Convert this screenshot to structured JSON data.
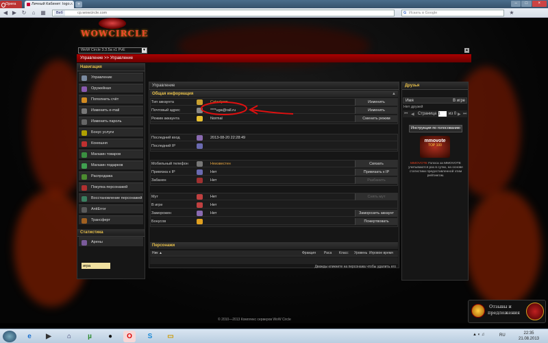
{
  "browser": {
    "opera_label": "Opera",
    "tab_title": "Личный Кабинет: logo...",
    "url": "cp.wowcircle.com",
    "web_label": "Веб",
    "search_placeholder": "Искать в Google",
    "new_tab": "+"
  },
  "site": {
    "logo": "WOWCIRCLE",
    "realm_select": "WoW Circle 3.3.5a x1 PvE",
    "breadcrumb": "Управление >> Управление",
    "footer": "© 2010—2013 Комплекс серверов WoW Circle"
  },
  "sidebar": {
    "nav_title": "Навигация",
    "items": [
      {
        "label": "Управление",
        "icon": "gear-icon",
        "color": "#7a8aa0"
      },
      {
        "label": "Оружейная",
        "icon": "crossed-swords-icon",
        "color": "#8a5ab0"
      },
      {
        "label": "Пополнить счёт",
        "icon": "coins-icon",
        "color": "#d28a20"
      },
      {
        "label": "Изменить e-mail",
        "icon": "envelope-icon",
        "color": "#777"
      },
      {
        "label": "Изменить пароль",
        "icon": "key-icon",
        "color": "#666"
      },
      {
        "label": "Бонус услуги",
        "icon": "bonus-icon",
        "color": "#b0a000"
      },
      {
        "label": "Конюшня",
        "icon": "horse-icon",
        "color": "#c03030"
      },
      {
        "label": "Магазин товаров",
        "icon": "shop-icon",
        "color": "#3a9040"
      },
      {
        "label": "Магазин подарков",
        "icon": "gift-icon",
        "color": "#40a050"
      },
      {
        "label": "Распродажа",
        "icon": "sale-icon",
        "color": "#4c8c30"
      },
      {
        "label": "Покупка персонажей",
        "icon": "character-buy-icon",
        "color": "#b03030"
      },
      {
        "label": "Восстановление персонажей",
        "icon": "restore-icon",
        "color": "#3a8060"
      },
      {
        "label": "AntiError",
        "icon": "antierror-icon",
        "color": "#5a5a5a"
      },
      {
        "label": "Трансферт",
        "icon": "transfer-icon",
        "color": "#a06020"
      }
    ],
    "stats_title": "Статистика",
    "stats_items": [
      {
        "label": "Арены",
        "icon": "arena-icon",
        "color": "#7a5a9a"
      }
    ],
    "input_value": "игра"
  },
  "main": {
    "title": "Управление",
    "general_title": "Общая информация",
    "general": [
      {
        "key": "Тип аккаунта",
        "value": "Cataclysm",
        "button": "Изменить",
        "icon": "expansion-icon",
        "icon_color": "#c9a030",
        "gold": true
      },
      {
        "key": "Почтовый адрес",
        "value": "****uga@rall.ru",
        "button": "Изменить",
        "icon": "mail-icon",
        "icon_color": "#888",
        "gold": false
      },
      {
        "key": "Режим аккаунта",
        "value": "Normal",
        "button": "Сменить режим",
        "icon": "star-icon",
        "icon_color": "#e8c030",
        "gold": false
      }
    ],
    "login": [
      {
        "key": "Последний вход",
        "value": "2013-08-20 22:28:49",
        "icon": "clock-icon",
        "icon_color": "#8a6ab0"
      },
      {
        "key": "Последний IP",
        "value": "",
        "icon": "network-icon",
        "icon_color": "#6a6ab0"
      }
    ],
    "security": [
      {
        "key": "Мобильный телефон",
        "value": "Неизвестен",
        "button": "Связать",
        "icon": "phone-icon",
        "icon_color": "#777",
        "dis": false,
        "gold": true
      },
      {
        "key": "Привязка к IP",
        "value": "Нет",
        "button": "Привязать к IP",
        "icon": "lock-icon",
        "icon_color": "#6a6ab0",
        "dis": false,
        "gold": false
      },
      {
        "key": "Забанен",
        "value": "Нет",
        "button": "Разбанить",
        "icon": "ban-icon",
        "icon_color": "#a03030",
        "dis": true,
        "gold": false
      }
    ],
    "status": [
      {
        "key": "Мут",
        "value": "Нет",
        "button": "Снять мут",
        "icon": "mute-icon",
        "icon_color": "#c04040",
        "dis": true
      },
      {
        "key": "В игре",
        "value": "Нет",
        "button": "",
        "icon": "game-icon",
        "icon_color": "#c04040",
        "dis": false
      },
      {
        "key": "Заморожен",
        "value": "Нет",
        "button": "Заморозить аккаунт",
        "icon": "freeze-icon",
        "icon_color": "#8a6ab0",
        "dis": false
      },
      {
        "key": "Бонусов",
        "value": "",
        "button": "Пожертвовать",
        "icon": "bonus-coin-icon",
        "icon_color": "#e0a020",
        "dis": false
      }
    ],
    "chars_title": "Персонажи",
    "chars_columns": [
      "Ник ▲",
      "Фракция",
      "Раса",
      "Класс",
      "Уровень",
      "Игровое время"
    ],
    "chars_hint": "Дважды кликните на персонажа чтобы удалить его"
  },
  "right": {
    "title": "Друзья",
    "col_name": "Имя",
    "col_status": "В игре",
    "no_friends": "Нет друзей",
    "page_label": "Страница",
    "page_value": "1",
    "page_of": "из 0",
    "vote_button": "Инструкция по голосованию",
    "mmovote_title": "mmovote",
    "mmovote_sub": "TOP 100",
    "vote_link": "MMOVOTE",
    "vote_text": "Голоса за MMOVOTE учитываются раз в сутки, на основе статистики предоставленной этим рейтингом."
  },
  "feedback": {
    "line1": "Отзывы и",
    "line2": "предложения"
  },
  "taskbar": {
    "lang": "RU",
    "time": "22:35",
    "date": "21.08.2013"
  }
}
